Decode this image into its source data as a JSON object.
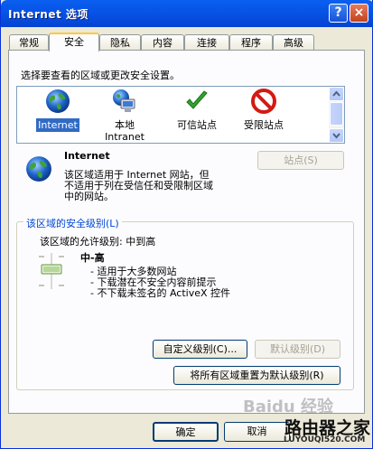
{
  "window": {
    "title": "Internet 选项",
    "help_label": "?",
    "close_label": "×"
  },
  "tabs": [
    "常规",
    "安全",
    "隐私",
    "内容",
    "连接",
    "程序",
    "高级"
  ],
  "active_tab": "安全",
  "zones": {
    "instruction": "选择要查看的区域或更改安全设置。",
    "items": [
      {
        "label": "Internet",
        "icon": "globe-icon"
      },
      {
        "label": "本地\nIntranet",
        "icon": "local-intranet-icon"
      },
      {
        "label": "可信站点",
        "icon": "checkmark-icon"
      },
      {
        "label": "受限站点",
        "icon": "no-entry-icon"
      }
    ],
    "selected": "Internet"
  },
  "zone_info": {
    "name": "Internet",
    "description_line1": "该区域适用于 Internet 网站，但",
    "description_line2": "不适用于列在受信任和受限制区域",
    "description_line3": "中的网站。",
    "sites_button": "站点(S)"
  },
  "security_level": {
    "group_title": "该区域的安全级别(L)",
    "allowed_levels": "该区域的允许级别: 中到高",
    "level_name": "中-高",
    "bullets": [
      "- 适用于大多数网站",
      "- 下载潜在不安全内容前提示",
      "- 不下载未签名的 ActiveX 控件"
    ],
    "custom_button": "自定义级别(C)...",
    "default_button": "默认级别(D)",
    "reset_all_button": "将所有区域重置为默认级别(R)"
  },
  "footer": {
    "ok": "确定",
    "cancel": "取消"
  },
  "watermarks": {
    "baidu": "Baidu 经验",
    "router_name": "路由器之家",
    "router_url": "LUYOUQI520.COM"
  },
  "colors": {
    "title_bar": "#0753e6",
    "group_title": "#0046d5",
    "selection": "#316ac5"
  }
}
